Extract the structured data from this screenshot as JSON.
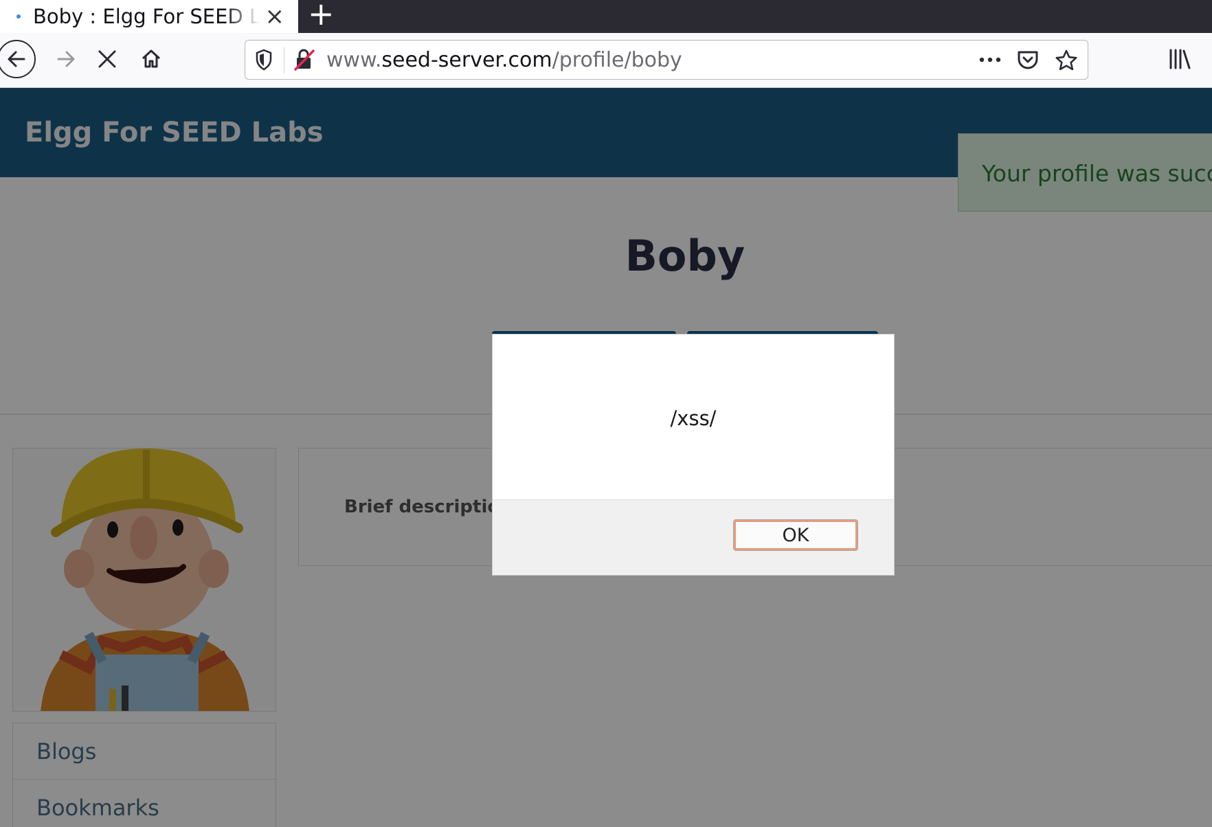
{
  "browser": {
    "tab_title": "Boby : Elgg For SEED Labs",
    "new_tab_label": "+",
    "url_prefix": "www.",
    "url_host": "seed-server.com",
    "url_path": "/profile/boby",
    "icons": [
      "back-arrow-icon",
      "forward-arrow-icon",
      "stop-icon",
      "home-icon",
      "shield-icon",
      "insecure-lock-icon",
      "more-icon",
      "pocket-icon",
      "star-icon",
      "library-icon",
      "close-icon"
    ]
  },
  "site": {
    "title": "Elgg For SEED Labs",
    "notice": "Your profile was succes",
    "header_color": "#1a5e86"
  },
  "profile": {
    "name": "Boby",
    "brief_label": "Brief description",
    "menu": [
      "Blogs",
      "Bookmarks"
    ]
  },
  "dialog": {
    "message": "/xss/",
    "ok_label": "OK"
  }
}
